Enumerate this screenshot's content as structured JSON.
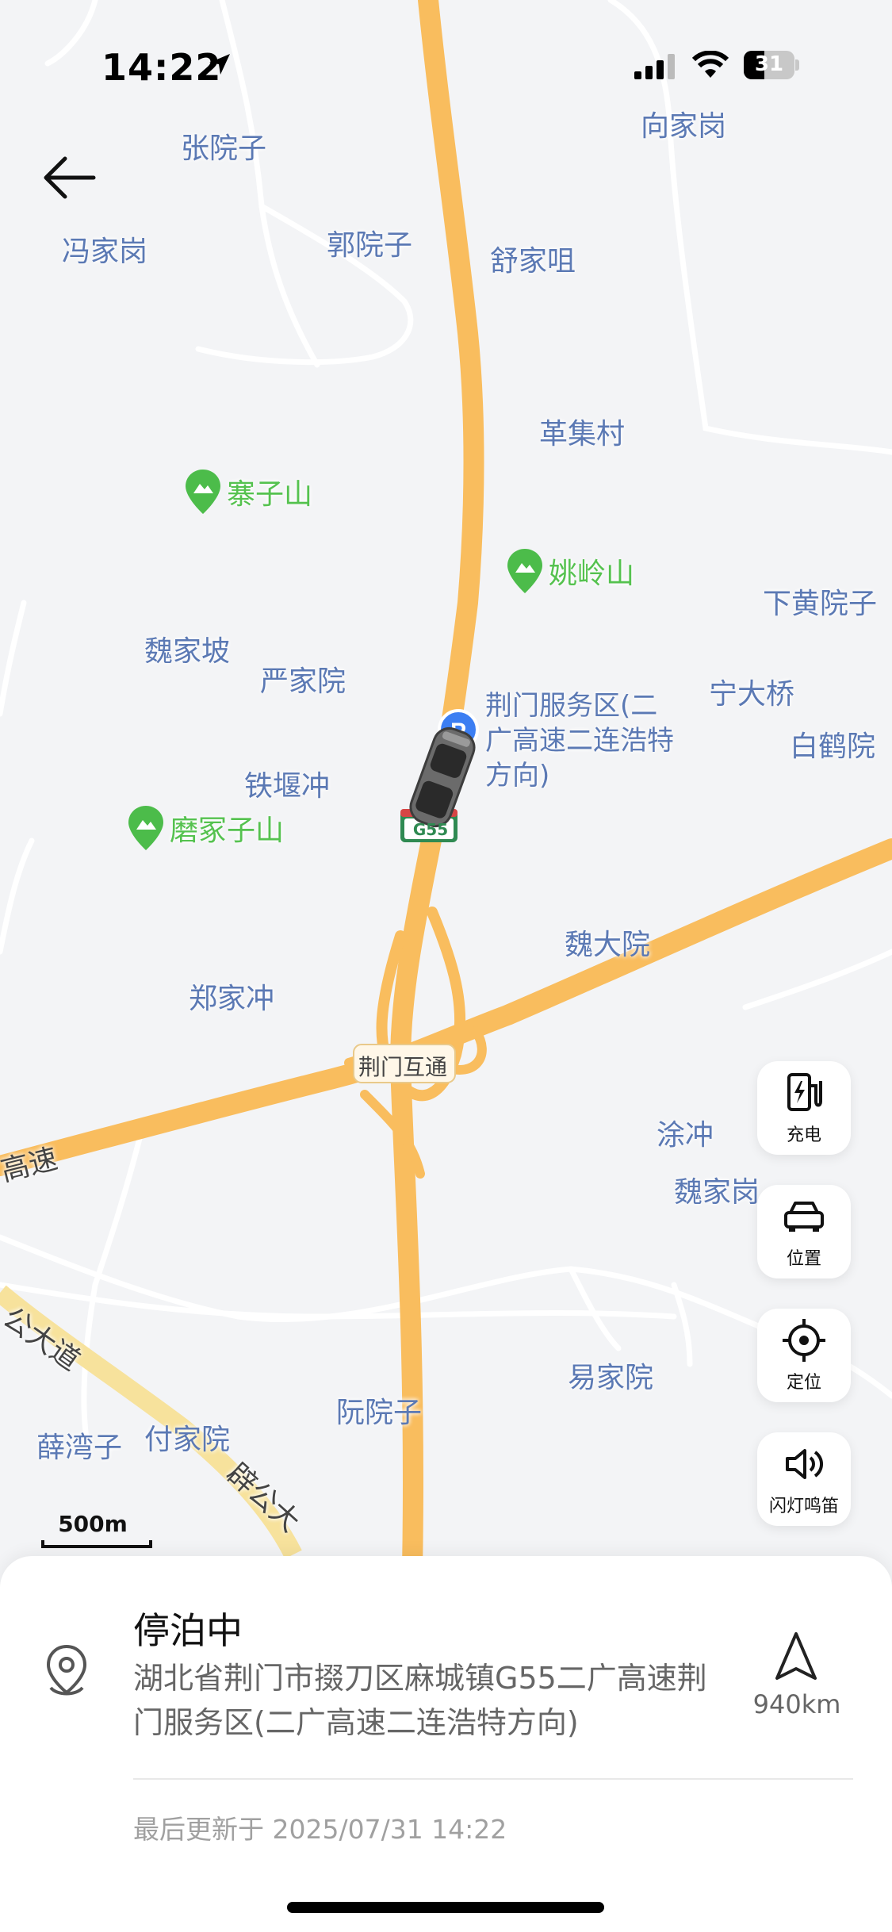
{
  "status_bar": {
    "time": "14:22",
    "battery": "31"
  },
  "map": {
    "place_labels": [
      {
        "id": "zhangyuanzi",
        "text": "张院子"
      },
      {
        "id": "fengjiagang",
        "text": "冯家岗"
      },
      {
        "id": "guoyuanzi",
        "text": "郭院子"
      },
      {
        "id": "shujiazui",
        "text": "舒家咀"
      },
      {
        "id": "xiangjiagang",
        "text": "向家岗"
      },
      {
        "id": "gejicun",
        "text": "革集村"
      },
      {
        "id": "xiahuangyuanzi",
        "text": "下黄院子"
      },
      {
        "id": "weijiapo",
        "text": "魏家坡"
      },
      {
        "id": "yanjiayuan",
        "text": "严家院"
      },
      {
        "id": "ningdaqiao",
        "text": "宁大桥"
      },
      {
        "id": "baihe",
        "text": "白鹤院"
      },
      {
        "id": "tieyanchong",
        "text": "铁堰冲"
      },
      {
        "id": "weidayuan",
        "text": "魏大院"
      },
      {
        "id": "zhengjiachong",
        "text": "郑家冲"
      },
      {
        "id": "tuchong",
        "text": "涂冲"
      },
      {
        "id": "weijiagang",
        "text": "魏家岗"
      },
      {
        "id": "yijiayuan",
        "text": "易家院"
      },
      {
        "id": "ruanyuanzi",
        "text": "阮院子"
      },
      {
        "id": "xuewanzi",
        "text": "薛湾子"
      },
      {
        "id": "fujiayuan",
        "text": "付家院"
      },
      {
        "id": "gaosu",
        "text": "高速"
      },
      {
        "id": "gongdadao",
        "text": "公大道"
      },
      {
        "id": "pigongda",
        "text": "辟公大"
      }
    ],
    "poi_labels": [
      {
        "id": "zhaizishan",
        "text": "寨子山"
      },
      {
        "id": "yaolingshan",
        "text": "姚岭山"
      },
      {
        "id": "mozhongzishan",
        "text": "磨冢子山"
      }
    ],
    "service_area": "荆门服务区(二广高速二连浩特方向)",
    "interchange": "荆门互通",
    "highway_shield": "G55",
    "scale": "500m"
  },
  "side_buttons": [
    {
      "id": "charge",
      "label": "充电",
      "icon": "charging-station-icon"
    },
    {
      "id": "position",
      "label": "位置",
      "icon": "car-icon"
    },
    {
      "id": "locate",
      "label": "定位",
      "icon": "crosshair-icon"
    },
    {
      "id": "horn",
      "label": "闪灯鸣笛",
      "icon": "speaker-icon"
    }
  ],
  "sheet": {
    "status": "停泊中",
    "address": "湖北省荆门市掇刀区麻城镇G55二广高速荆门服务区(二广高速二连浩特方向)",
    "distance": "940km",
    "updated": "最后更新于 2025/07/31 14:22"
  },
  "colors": {
    "road": "#f9bd5e",
    "label": "#5b79b4",
    "poi": "#55c24f",
    "bg": "#f3f4f6"
  }
}
